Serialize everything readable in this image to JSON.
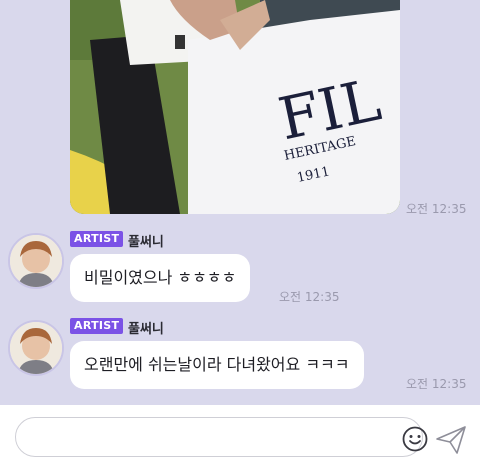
{
  "messages": [
    {
      "type": "photo",
      "time": "오전 12:35"
    },
    {
      "type": "text",
      "badge": "ARTIST",
      "sender": "풀써니",
      "text": "비밀이였으나 ㅎㅎㅎㅎ",
      "time": "오전 12:35"
    },
    {
      "type": "text",
      "badge": "ARTIST",
      "sender": "풀써니",
      "text": "오랜만에 쉬는날이라 다녀왔어요 ㅋㅋㅋ",
      "time": "오전 12:35"
    }
  ],
  "photo_print": {
    "line1": "FIL",
    "line2": "HERITAGE",
    "line3": "1911"
  },
  "composer": {
    "placeholder": "",
    "value": ""
  },
  "icons": {
    "emoji": "emoji-icon",
    "send": "send-icon",
    "avatar": "profile-avatar"
  },
  "colors": {
    "background": "#d9d8ec",
    "badge": "#7b52e6",
    "bubble": "#ffffff",
    "time": "#9a99ad"
  }
}
